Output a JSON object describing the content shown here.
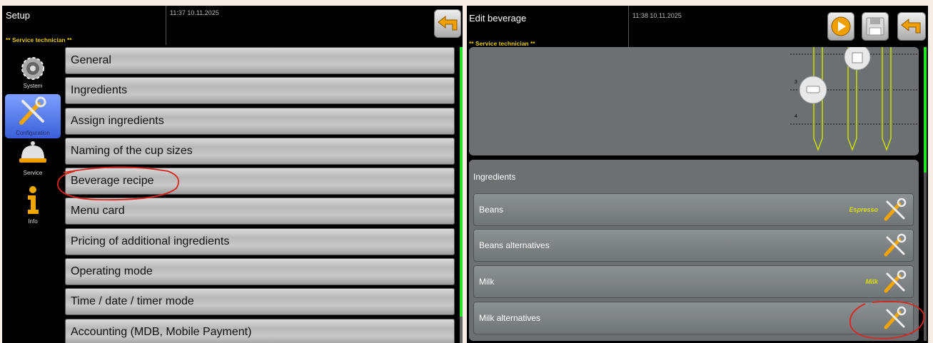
{
  "left": {
    "title": "Setup",
    "role": "** Service technician **",
    "datetime": "11:37 10.11.2025",
    "back_icon": "back-arrow-icon",
    "sidebar": [
      {
        "label": "System",
        "icon": "gear-icon"
      },
      {
        "label": "Configuration",
        "icon": "tools-icon",
        "active": true
      },
      {
        "label": "Service",
        "icon": "service-bell-icon"
      },
      {
        "label": "Info",
        "icon": "info-icon"
      }
    ],
    "menu": [
      "General",
      "Ingredients",
      "Assign ingredients",
      "Naming of the cup sizes",
      "Beverage recipe",
      "Menu card",
      "Pricing of additional ingredients",
      "Operating mode",
      "Time / date / timer mode",
      "Accounting (MDB, Mobile Payment)"
    ]
  },
  "right": {
    "title": "Edit beverage",
    "role": "** Service technician **",
    "datetime": "11:38 10.11.2025",
    "toolbar_icons": [
      "play-icon",
      "save-icon",
      "back-arrow-icon"
    ],
    "diagram_levels": [
      "3",
      "4"
    ],
    "ingredients_title": "Ingredients",
    "ingredients": [
      {
        "name": "Beans",
        "tag": "Espresso"
      },
      {
        "name": "Beans alternatives",
        "tag": ""
      },
      {
        "name": "Milk",
        "tag": "Milk"
      },
      {
        "name": "Milk alternatives",
        "tag": ""
      }
    ]
  },
  "colors": {
    "accent_green": "#28e028",
    "role_yellow": "#e8c800",
    "tag_yellow": "#d4e000",
    "annotation_red": "#d8261e"
  }
}
